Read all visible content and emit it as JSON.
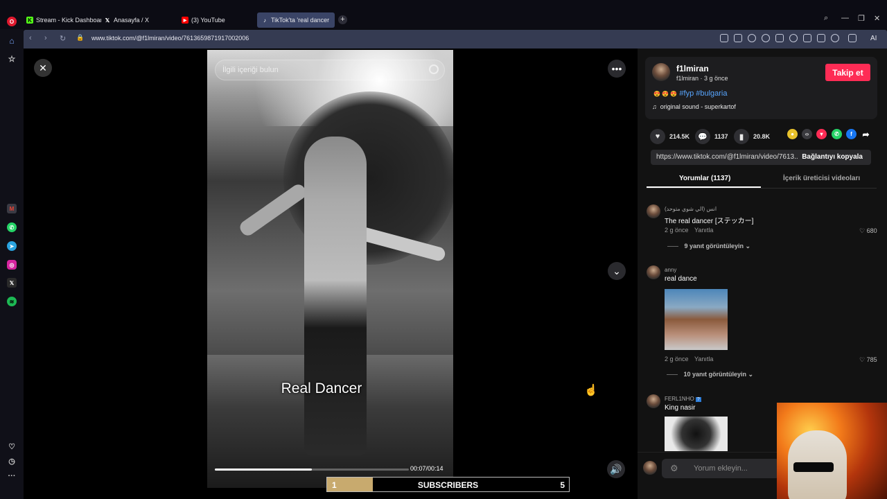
{
  "tabs": [
    {
      "label": "Stream - Kick Dashboard",
      "icon": "kick-icon",
      "color": "#53fc18"
    },
    {
      "label": "Anasayfa / X",
      "icon": "x-icon",
      "color": "#ffffff"
    },
    {
      "label": "(3) YouTube",
      "icon": "youtube-icon",
      "color": "#ff0000"
    },
    {
      "label": "TikTok'ta 'real dancer",
      "icon": "tiktok-icon",
      "color": "#ffffff",
      "active": true
    }
  ],
  "address": {
    "url": "www.tiktok.com/@f1lmiran/video/7613659871917002006"
  },
  "toolbar": {
    "ai_label": "AI"
  },
  "video": {
    "search_placeholder": "İlgili içeriği bulun",
    "overlay_text": "Real Dancer",
    "timecode": "00:07/00:14",
    "progress": 0.5
  },
  "author": {
    "username": "f1lmiran",
    "subtitle": "f1lmiran · 3 g önce",
    "follow_label": "Takip et",
    "caption_emojis": "😍 😍 😍",
    "hashtags": "#fyp #bulgaria",
    "sound": "original sound - superkartof"
  },
  "stats": {
    "likes": "214.5K",
    "comments": "1137",
    "saves": "20.8K"
  },
  "share": {
    "link": "https://www.tiktok.com/@f1lmiran/video/7613...",
    "copy_label": "Bağlantıyı kopyala"
  },
  "panel_tabs": {
    "comments": "Yorumlar (1137)",
    "creator_videos": "İçerik üreticisi videoları"
  },
  "comments": [
    {
      "user": "انس (الي شوي متوحد)",
      "text": "The real dancer [ステッカー]",
      "time": "2 g önce",
      "reply": "Yanıtla",
      "likes": "680",
      "replies": "9 yanıt görüntüleyin"
    },
    {
      "user": "anny",
      "text": "real dance",
      "time": "2 g önce",
      "reply": "Yanıtla",
      "likes": "785",
      "replies": "10 yanıt görüntüleyin"
    },
    {
      "user": "FERL1NHO",
      "text": "King nasir"
    }
  ],
  "composer": {
    "placeholder": "Yorum ekleyin..."
  },
  "subscribers": {
    "left": "1",
    "label": "SUBSCRIBERS",
    "right": "5",
    "fill": 0.19
  }
}
